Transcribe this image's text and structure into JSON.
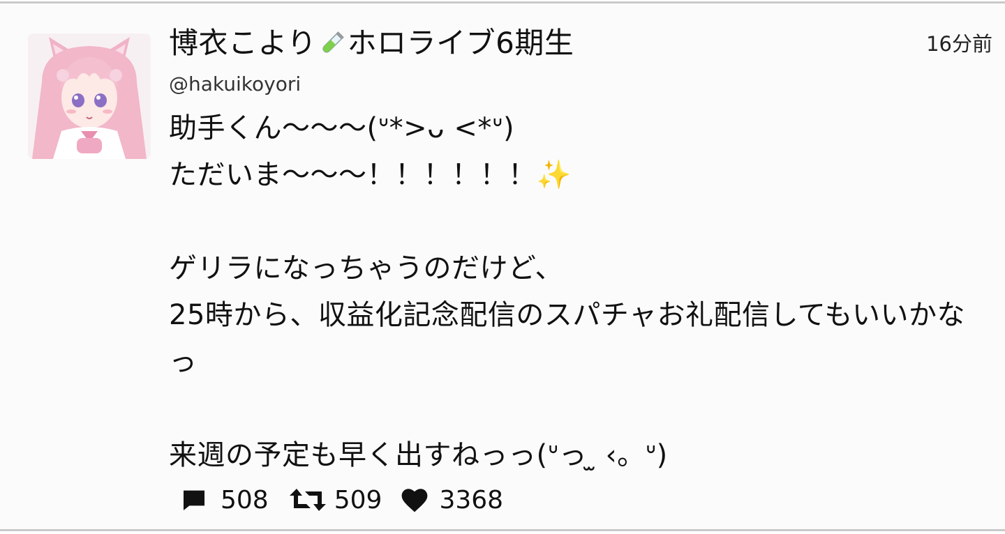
{
  "tweet": {
    "display_name_prefix": "博衣こより",
    "display_name_suffix": "ホロライブ6期生",
    "name_icon": "test-tube-icon",
    "handle": "@hakuikoyori",
    "timestamp": "16分前",
    "body": "助手くん〜〜〜(ᐡ*>ᴗ <*ᐡ)\nただいま〜〜〜！！！！！！✨\n\nゲリラになっちゃうのだけど、\n25時から、収益化記念配信のスパチャお礼配信してもいいかなっ\n\n来週の予定も早く出すねっっ(ᐡっ ̫ ‹。ᐡ)",
    "avatar_icon": "avatar-anime-girl-pink-hair",
    "stats": {
      "replies": "508",
      "retweets": "509",
      "likes": "3368"
    },
    "icons": {
      "reply": "comment-bubble-icon",
      "retweet": "retweet-arrows-icon",
      "like": "heart-icon"
    }
  },
  "colors": {
    "background": "#fbfbfb",
    "border": "#c9c9c9",
    "text": "#111111",
    "avatar_hair": "#f2b7c9"
  }
}
